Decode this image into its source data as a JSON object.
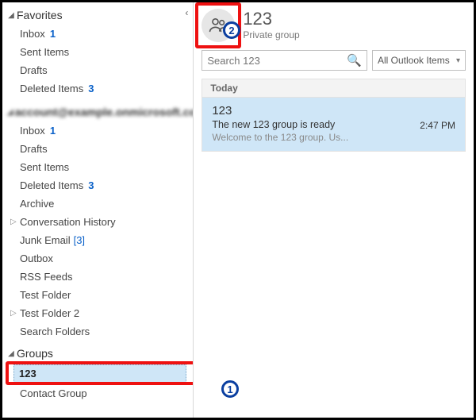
{
  "favorites": {
    "header": "Favorites",
    "items": [
      {
        "label": "Inbox",
        "count": "1"
      },
      {
        "label": "Sent Items"
      },
      {
        "label": "Drafts"
      },
      {
        "label": "Deleted Items",
        "count": "3"
      }
    ]
  },
  "account": {
    "header_obscured": "account@example.onmicrosoft.com",
    "items": [
      {
        "label": "Inbox",
        "count": "1"
      },
      {
        "label": "Drafts"
      },
      {
        "label": "Sent Items"
      },
      {
        "label": "Deleted Items",
        "count": "3"
      },
      {
        "label": "Archive"
      },
      {
        "label": "Conversation History",
        "expandable": true
      },
      {
        "label": "Junk Email",
        "bracket": "[3]"
      },
      {
        "label": "Outbox"
      },
      {
        "label": "RSS Feeds"
      },
      {
        "label": "Test Folder"
      },
      {
        "label": "Test Folder 2",
        "expandable": true
      },
      {
        "label": "Search Folders"
      }
    ]
  },
  "groups": {
    "header": "Groups",
    "selected": "123",
    "items": [
      {
        "label": "Contact Group"
      }
    ]
  },
  "group_header": {
    "title": "123",
    "subtitle": "Private group"
  },
  "search": {
    "placeholder": "Search 123"
  },
  "filter": {
    "label": "All Outlook Items"
  },
  "messages": {
    "day": "Today",
    "items": [
      {
        "from": "123",
        "subject": "The new 123 group is ready",
        "preview": "Welcome to the 123 group.  Us...",
        "time": "2:47 PM"
      }
    ]
  },
  "annotations": {
    "badge1": "1",
    "badge2": "2"
  }
}
